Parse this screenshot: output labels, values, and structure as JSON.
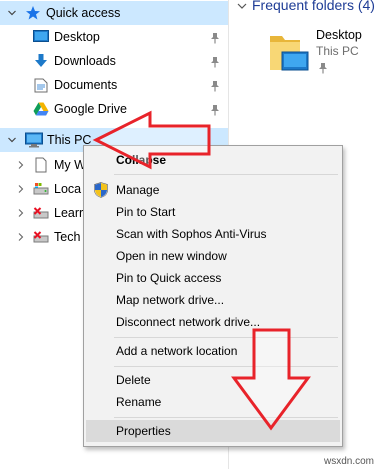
{
  "nav": {
    "quick_access": "Quick access",
    "desktop": "Desktop",
    "downloads": "Downloads",
    "documents": "Documents",
    "google_drive": "Google Drive",
    "this_pc": "This PC",
    "child1": "My W",
    "child2": "Loca",
    "child3": "Learr",
    "child4": "Tech"
  },
  "content": {
    "group_header": "Frequent folders (4)",
    "folder_name": "Desktop",
    "folder_location": "This PC"
  },
  "context_menu": {
    "items": [
      "Collapse",
      "Manage",
      "Pin to Start",
      "Scan with Sophos Anti-Virus",
      "Open in new window",
      "Pin to Quick access",
      "Map network drive...",
      "Disconnect network drive...",
      "Add a network location",
      "Delete",
      "Rename",
      "Properties"
    ]
  },
  "watermark": "wsxdn.com",
  "colors": {
    "selection": "#cce8ff",
    "menu_bg": "#f2f2f2",
    "menu_hover": "#dadada",
    "annotation_red": "#e8232a",
    "header_blue": "#1e3c96"
  }
}
